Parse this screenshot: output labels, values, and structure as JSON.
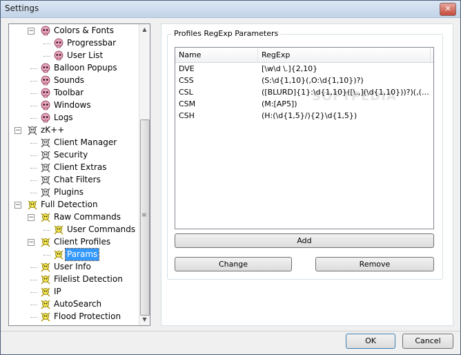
{
  "window": {
    "title": "Settings",
    "close_label": "✕"
  },
  "tree": {
    "items": [
      {
        "label": "Colors & Fonts",
        "expander": "−",
        "icon": "skull-pink-icon"
      },
      {
        "label": "Progressbar",
        "icon": "skull-pink-icon"
      },
      {
        "label": "User List",
        "icon": "skull-pink-icon"
      },
      {
        "label": "Balloon Popups",
        "icon": "skull-pink-icon"
      },
      {
        "label": "Sounds",
        "icon": "skull-pink-icon"
      },
      {
        "label": "Toolbar",
        "icon": "skull-pink-icon"
      },
      {
        "label": "Windows",
        "icon": "skull-pink-icon"
      },
      {
        "label": "Logs",
        "icon": "skull-pink-icon"
      },
      {
        "label": "zK++",
        "expander": "−",
        "icon": "skull-crossbones-icon"
      },
      {
        "label": "Client Manager",
        "icon": "skull-crossbones-icon"
      },
      {
        "label": "Security",
        "icon": "skull-crossbones-icon"
      },
      {
        "label": "Client Extras",
        "icon": "skull-crossbones-icon"
      },
      {
        "label": "Chat Filters",
        "icon": "skull-crossbones-icon"
      },
      {
        "label": "Plugins",
        "icon": "skull-crossbones-icon"
      },
      {
        "label": "Full Detection",
        "expander": "−",
        "icon": "skull-yellow-icon"
      },
      {
        "label": "Raw Commands",
        "expander": "−",
        "icon": "skull-yellow-icon"
      },
      {
        "label": "User Commands",
        "icon": "skull-yellow-icon"
      },
      {
        "label": "Client Profiles",
        "expander": "−",
        "icon": "skull-yellow-icon"
      },
      {
        "label": "Params",
        "icon": "skull-yellow-icon",
        "selected": true
      },
      {
        "label": "User Info",
        "icon": "skull-yellow-icon"
      },
      {
        "label": "Filelist Detection",
        "icon": "skull-yellow-icon"
      },
      {
        "label": "IP",
        "icon": "skull-yellow-icon"
      },
      {
        "label": "AutoSearch",
        "icon": "skull-yellow-icon"
      },
      {
        "label": "Flood Protection",
        "icon": "skull-yellow-icon"
      }
    ]
  },
  "panel": {
    "group_title": "Profiles RegExp Parameters",
    "columns": {
      "name": "Name",
      "regexp": "RegExp"
    },
    "rows": [
      {
        "name": "DVE",
        "regexp": "[\\w\\d \\.]{2,10}"
      },
      {
        "name": "CSS",
        "regexp": "(S:\\d{1,10}(,O:\\d{1,10})?)"
      },
      {
        "name": "CSL",
        "regexp": "([BLURD]{1}:\\d{1,10}([\\.,](\\d{1,10}))?)(,([BL..."
      },
      {
        "name": "CSM",
        "regexp": "(M:[AP5])"
      },
      {
        "name": "CSH",
        "regexp": "(H:(\\d{1,5}/){2}\\d{1,5})"
      }
    ],
    "watermark": "SOFTPEDIA",
    "add_label": "Add",
    "change_label": "Change",
    "remove_label": "Remove"
  },
  "footer": {
    "ok_label": "OK",
    "cancel_label": "Cancel"
  },
  "colors": {
    "selection": "#3399ff",
    "title_bg": "#c3d4e8"
  }
}
